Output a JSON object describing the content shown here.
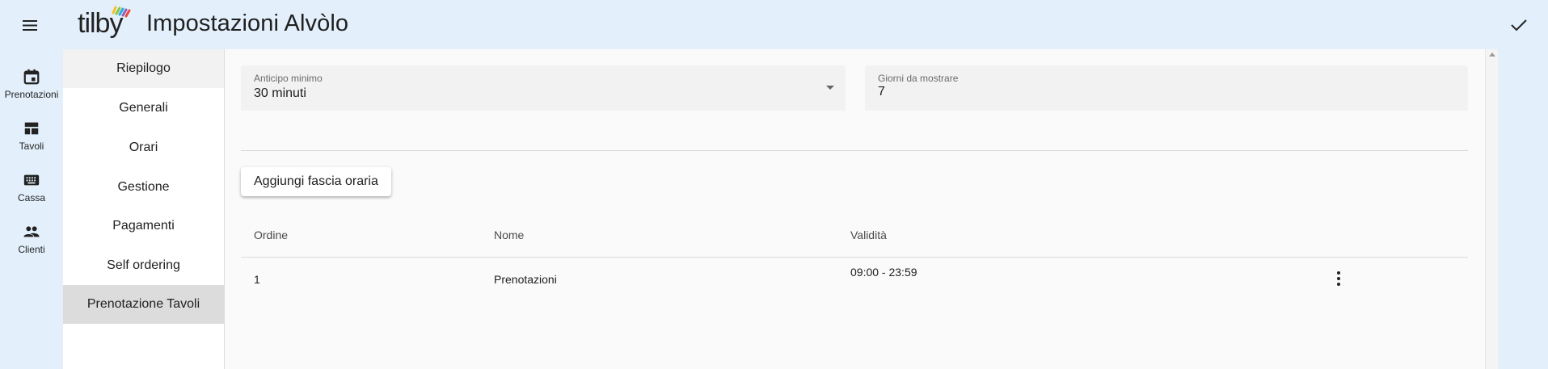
{
  "header": {
    "title": "Impostazioni Alvòlo",
    "logo_text": "tilby",
    "menu_icon": "menu-icon",
    "confirm_icon": "check-icon"
  },
  "rail": {
    "items": [
      {
        "label": "Prenotazioni",
        "icon": "calendar-icon"
      },
      {
        "label": "Tavoli",
        "icon": "dashboard-icon"
      },
      {
        "label": "Cassa",
        "icon": "keyboard-icon"
      },
      {
        "label": "Clienti",
        "icon": "people-icon"
      }
    ]
  },
  "settings_nav": {
    "items": [
      {
        "label": "Riepilogo"
      },
      {
        "label": "Generali"
      },
      {
        "label": "Orari"
      },
      {
        "label": "Gestione"
      },
      {
        "label": "Pagamenti"
      },
      {
        "label": "Self ordering"
      },
      {
        "label": "Prenotazione Tavoli",
        "active": true
      }
    ]
  },
  "form": {
    "min_advance": {
      "label": "Anticipo minimo",
      "value": "30 minuti"
    },
    "days_to_show": {
      "label": "Giorni da mostrare",
      "value": "7"
    }
  },
  "add_slot_button": "Aggiungi fascia oraria",
  "table": {
    "columns": [
      "Ordine",
      "Nome",
      "Validità"
    ],
    "rows": [
      {
        "order": "1",
        "name": "Prenotazioni",
        "validity": "09:00 - 23:59"
      }
    ]
  },
  "colors": {
    "shell_background": "#e3f0fb",
    "active_nav": "#dcdcdc",
    "content_background": "#fafafa"
  }
}
